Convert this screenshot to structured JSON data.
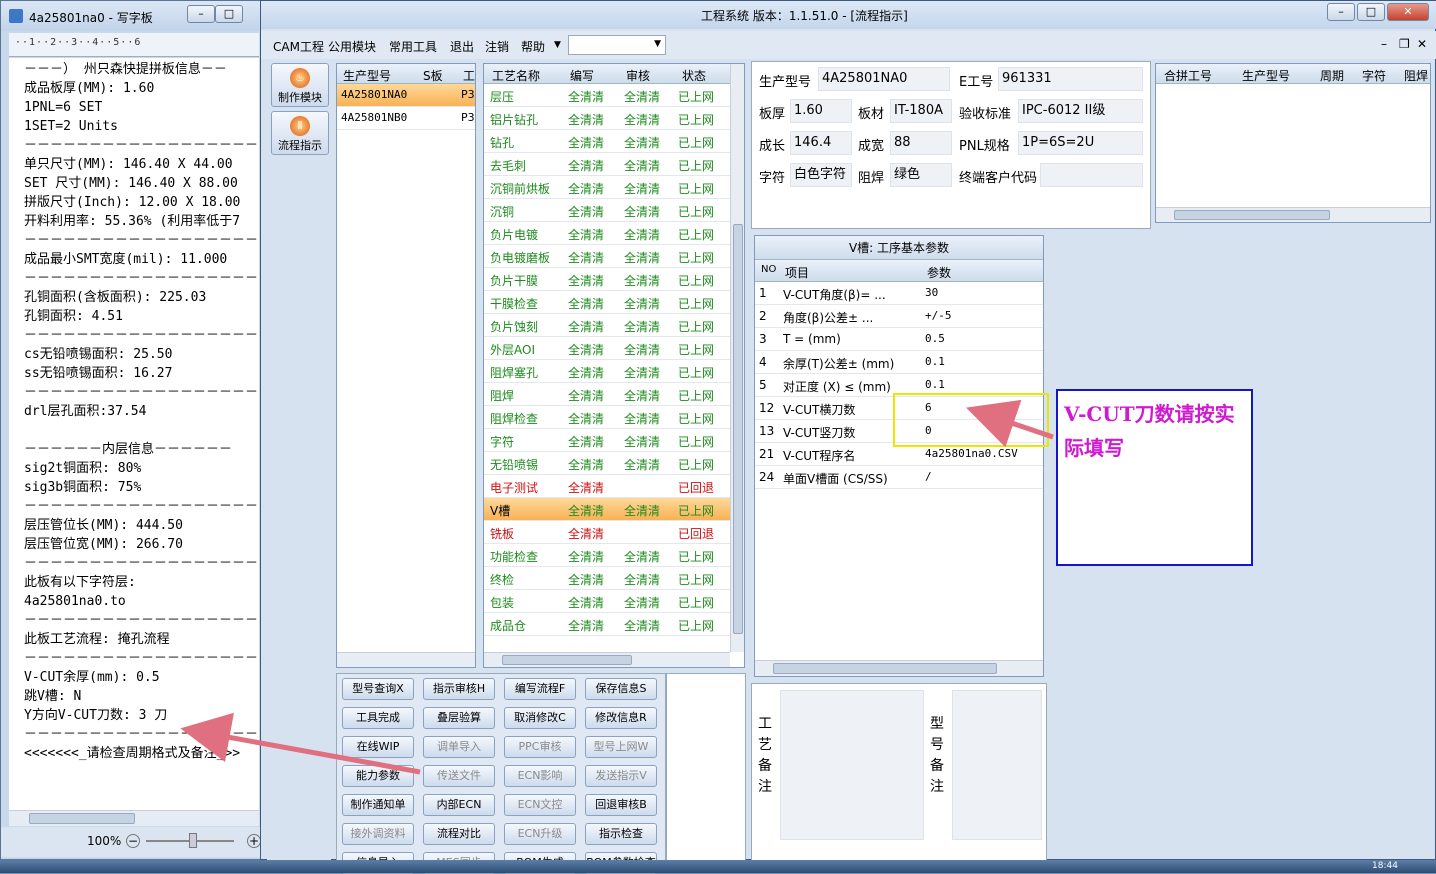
{
  "wordpad": {
    "title": "4a25801na0 - 写字板",
    "ruler": "··1··2··3··4··5··6",
    "lines": [
      "－－－） 州只森快提拼板信息－－",
      "成品板厚(MM): 1.60",
      "1PNL=6 SET",
      "1SET=2 Units",
      "－－－－－－－－－－－－－－－－－－－",
      "单只尺寸(MM): 146.40 X 44.00",
      "SET 尺寸(MM): 146.40 X 88.00",
      "拼版尺寸(Inch): 12.00 X 18.00",
      "开料利用率: 55.36% (利用率低于7",
      "－－－－－－－－－－－－－－－－－－－",
      "成品最小SMT宽度(mil): 11.000",
      "－－－－－－－－－－－－－－－－－－－",
      "孔铜面积(含板面积): 225.03",
      "孔铜面积: 4.51",
      "－－－－－－－－－－－－－－－－－－－",
      "cs无铅喷锡面积: 25.50",
      "ss无铅喷锡面积: 16.27",
      "－－－－－－－－－－－－－－－－－－－",
      "drl层孔面积:37.54",
      "",
      "－－－－－－内层信息－－－－－－",
      "sig2t铜面积: 80%",
      "sig3b铜面积: 75%",
      "－－－－－－－－－－－－－－－－－－－",
      "层压管位长(MM): 444.50",
      "层压管位宽(MM): 266.70",
      "－－－－－－－－－－－－－－－－－－－",
      "此板有以下字符层:",
      "4a25801na0.to",
      "－－－－－－－－－－－－－－－－－－－",
      "此板工艺流程: 掩孔流程",
      "－－－－－－－－－－－－－－－－－－－",
      "V-CUT余厚(mm): 0.5",
      "跳V槽: N",
      "Y方向V-CUT刀数: 3 刀",
      "－－－－－－－－－－－－－－－－－－－",
      "<<<<<<<_请检查周期格式及备注_>>"
    ],
    "zoom": "100%"
  },
  "main": {
    "title": "工程系统   版本：1.1.51.0 - [流程指示]",
    "menu": [
      "CAM工程",
      "公用模块",
      "常用工具",
      "退出",
      "注销",
      "帮助"
    ],
    "left_buttons": [
      "制作模块",
      "流程指示"
    ],
    "models": {
      "headers": [
        "生产型号",
        "S板",
        "工"
      ],
      "rows": [
        {
          "model": "4A25801NA0",
          "s": "",
          "p": "P3"
        },
        {
          "model": "4A25801NB0",
          "s": "",
          "p": "P3"
        }
      ]
    },
    "process": {
      "headers": [
        "工艺名称",
        "编写",
        "审核",
        "状态"
      ],
      "rows": [
        {
          "name": "层压",
          "w": "全清清",
          "a": "全清清",
          "s": "已上网",
          "red": false
        },
        {
          "name": "铝片钻孔",
          "w": "全清清",
          "a": "全清清",
          "s": "已上网",
          "red": false
        },
        {
          "name": "钻孔",
          "w": "全清清",
          "a": "全清清",
          "s": "已上网",
          "red": false
        },
        {
          "name": "去毛刺",
          "w": "全清清",
          "a": "全清清",
          "s": "已上网",
          "red": false
        },
        {
          "name": "沉铜前烘板",
          "w": "全清清",
          "a": "全清清",
          "s": "已上网",
          "red": false
        },
        {
          "name": "沉铜",
          "w": "全清清",
          "a": "全清清",
          "s": "已上网",
          "red": false
        },
        {
          "name": "负片电镀",
          "w": "全清清",
          "a": "全清清",
          "s": "已上网",
          "red": false
        },
        {
          "name": "负电镀磨板",
          "w": "全清清",
          "a": "全清清",
          "s": "已上网",
          "red": false
        },
        {
          "name": "负片干膜",
          "w": "全清清",
          "a": "全清清",
          "s": "已上网",
          "red": false
        },
        {
          "name": "干膜检查",
          "w": "全清清",
          "a": "全清清",
          "s": "已上网",
          "red": false
        },
        {
          "name": "负片蚀刻",
          "w": "全清清",
          "a": "全清清",
          "s": "已上网",
          "red": false
        },
        {
          "name": "外层AOI",
          "w": "全清清",
          "a": "全清清",
          "s": "已上网",
          "red": false
        },
        {
          "name": "阻焊塞孔",
          "w": "全清清",
          "a": "全清清",
          "s": "已上网",
          "red": false
        },
        {
          "name": "阻焊",
          "w": "全清清",
          "a": "全清清",
          "s": "已上网",
          "red": false
        },
        {
          "name": "阻焊检查",
          "w": "全清清",
          "a": "全清清",
          "s": "已上网",
          "red": false
        },
        {
          "name": "字符",
          "w": "全清清",
          "a": "全清清",
          "s": "已上网",
          "red": false
        },
        {
          "name": "无铅喷锡",
          "w": "全清清",
          "a": "全清清",
          "s": "已上网",
          "red": false
        },
        {
          "name": "电子测试",
          "w": "全清清",
          "a": "",
          "s": "已回退",
          "red": true
        },
        {
          "name": "V槽",
          "w": "全清清",
          "a": "全清清",
          "s": "已上网",
          "red": false,
          "selected": true
        },
        {
          "name": "铣板",
          "w": "全清清",
          "a": "",
          "s": "已回退",
          "red": true
        },
        {
          "name": "功能检查",
          "w": "全清清",
          "a": "全清清",
          "s": "已上网",
          "red": false
        },
        {
          "name": "终检",
          "w": "全清清",
          "a": "全清清",
          "s": "已上网",
          "red": false
        },
        {
          "name": "包装",
          "w": "全清清",
          "a": "全清清",
          "s": "已上网",
          "red": false
        },
        {
          "name": "成品仓",
          "w": "全清清",
          "a": "全清清",
          "s": "已上网",
          "red": false
        }
      ]
    },
    "buttons": [
      [
        "型号查询X",
        "指示审核H",
        "编写流程F",
        "保存信息S"
      ],
      [
        "工具完成",
        "叠层验算",
        "取消修改C",
        "修改信息R"
      ],
      [
        "在线WIP",
        "调单导入",
        "PPC审核",
        "型号上网W"
      ],
      [
        "能力参数",
        "传送文件",
        "ECN影响",
        "发送指示V"
      ],
      [
        "制作通知单",
        "内部ECN",
        "ECN文控",
        "回退审核B"
      ],
      [
        "接外调资料",
        "流程对比",
        "ECN升级",
        "指示检查"
      ],
      [
        "信息导入",
        "MES同步",
        "BOM生成",
        "BOM参数检查"
      ]
    ],
    "disabled_buttons": [
      "调单导入",
      "PPC审核",
      "型号上网W",
      "传送文件",
      "ECN影响",
      "发送指示V",
      "ECN文控",
      "接外调资料",
      "ECN升级",
      "MES同步"
    ],
    "info": {
      "model_label": "生产型号",
      "model": "4A25801NA0",
      "eno_label": "E工号",
      "eno": "961331",
      "thick_label": "板厚",
      "thick": "1.60",
      "mat_label": "板材",
      "mat": "IT-180A",
      "std_label": "验收标准",
      "std": "IPC-6012 II级",
      "len_label": "成长",
      "len": "146.4",
      "wid_label": "成宽",
      "wid": "88",
      "pnl_label": "PNL规格",
      "pnl": "1P=6S=2U",
      "char_label": "字符",
      "char": "白色字符",
      "mask_label": "阻焊",
      "mask": "绿色",
      "cust_label": "终端客户代码",
      "cust": ""
    },
    "merge_headers": [
      "合拼工号",
      "生产型号",
      "周期",
      "字符",
      "阻焊"
    ],
    "vcut": {
      "title": "V槽: 工序基本参数",
      "headers": [
        "NO",
        "项目",
        "参数"
      ],
      "rows": [
        {
          "no": "1",
          "item": "V-CUT角度(β)=  ...",
          "val": "30"
        },
        {
          "no": "2",
          "item": "角度(β)公差±  ...",
          "val": "+/-5"
        },
        {
          "no": "3",
          "item": "T =  (mm)",
          "val": "0.5"
        },
        {
          "no": "4",
          "item": "余厚(T)公差±  (mm)",
          "val": "0.1"
        },
        {
          "no": "5",
          "item": "对正度 (X) ≤ (mm)",
          "val": "0.1"
        },
        {
          "no": "12",
          "item": "V-CUT横刀数",
          "val": "6"
        },
        {
          "no": "13",
          "item": "V-CUT竖刀数",
          "val": "0"
        },
        {
          "no": "21",
          "item": "V-CUT程序名",
          "val": "4a25801na0.CSV"
        },
        {
          "no": "24",
          "item": "单面V槽面 (CS/SS)",
          "val": "/"
        }
      ]
    },
    "remarks": {
      "process_label": "工艺备注",
      "model_label": "型号备注"
    },
    "callout": "V-CUT刀数请按实际填写"
  },
  "taskbar": {
    "time": "18:44"
  },
  "colors": {
    "callout_text": "#d01ad0",
    "callout_border": "#1414c8",
    "arrow": "#e07080",
    "highlight": "#e8e800"
  }
}
